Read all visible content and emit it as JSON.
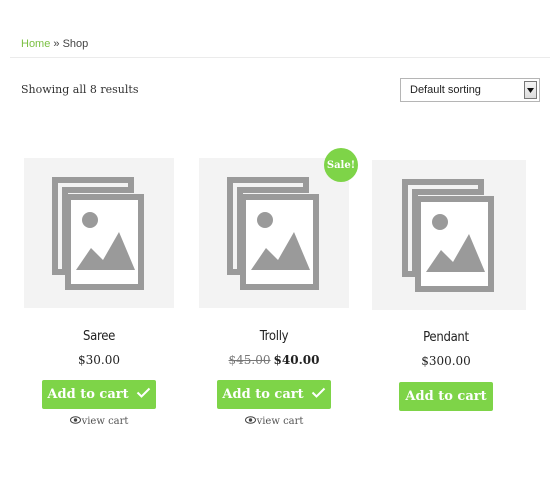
{
  "breadcrumb": {
    "home": "Home",
    "separator": "»",
    "current": "Shop"
  },
  "shop": {
    "result_count": "Showing all 8 results"
  },
  "sorting": {
    "selected": "Default sorting"
  },
  "products": [
    {
      "title": "Saree",
      "price": "$30.00",
      "button": "Add to cart",
      "view_cart": "view cart",
      "in_cart": true
    },
    {
      "title": "Trolly",
      "old_price": "$45.00",
      "price": "$40.00",
      "badge": "Sale!",
      "button": "Add to cart",
      "view_cart": "view cart",
      "in_cart": true
    },
    {
      "title": "Pendant",
      "price": "$300.00",
      "button": "Add to cart",
      "in_cart": false
    }
  ],
  "colors": {
    "accent": "#7ed448",
    "link": "#7bc043",
    "placeholder_bg": "#f3f3f3",
    "placeholder_icon": "#9a9a9a"
  },
  "icons": {
    "placeholder": "image-placeholder-icon",
    "check": "checkmark-icon",
    "eye": "eye-icon",
    "dropdown": "dropdown-arrow-icon"
  }
}
